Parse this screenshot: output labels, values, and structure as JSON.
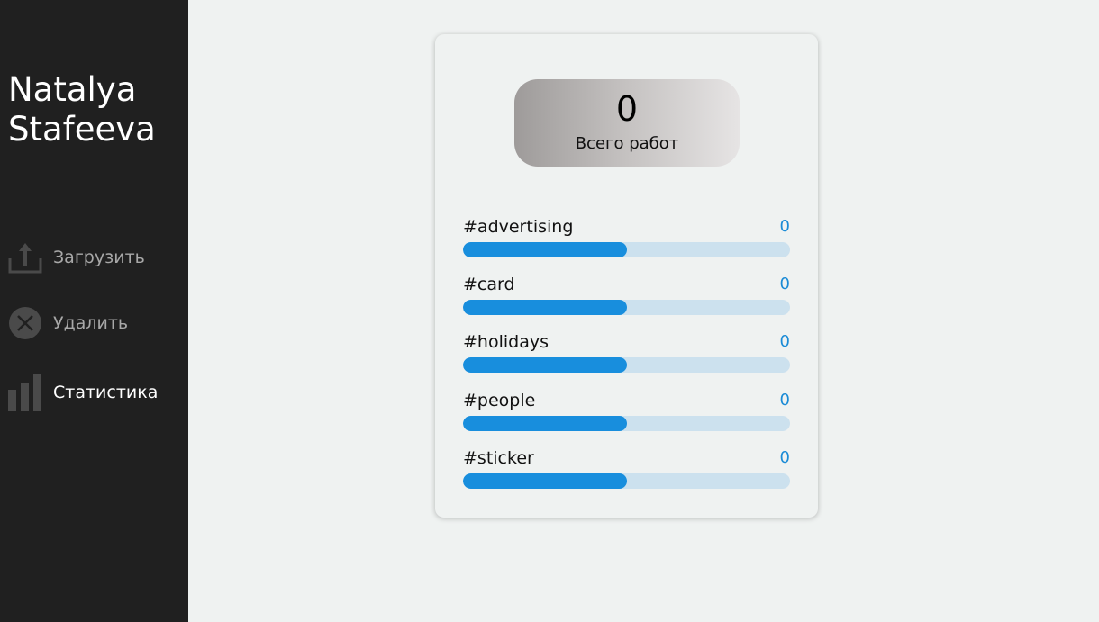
{
  "sidebar": {
    "brand": "Natalya Stafeeva",
    "items": [
      {
        "label": "Загрузить",
        "icon": "upload-icon",
        "active": false
      },
      {
        "label": "Удалить",
        "icon": "delete-icon",
        "active": false
      },
      {
        "label": "Статистика",
        "icon": "bar-chart-icon",
        "active": true
      }
    ]
  },
  "stats": {
    "total_count": "0",
    "total_label": "Всего работ",
    "rows": [
      {
        "tag": "#advertising",
        "value": "0",
        "fill_fraction": 0.5
      },
      {
        "tag": "#card",
        "value": "0",
        "fill_fraction": 0.5
      },
      {
        "tag": "#holidays",
        "value": "0",
        "fill_fraction": 0.5
      },
      {
        "tag": "#people",
        "value": "0",
        "fill_fraction": 0.5
      },
      {
        "tag": "#sticker",
        "value": "0",
        "fill_fraction": 0.5
      }
    ]
  },
  "colors": {
    "sidebar_bg": "#202020",
    "page_bg": "#eff2f1",
    "accent": "#188edd",
    "track": "#cce1ee",
    "icon_gray": "#4a4a4a"
  }
}
